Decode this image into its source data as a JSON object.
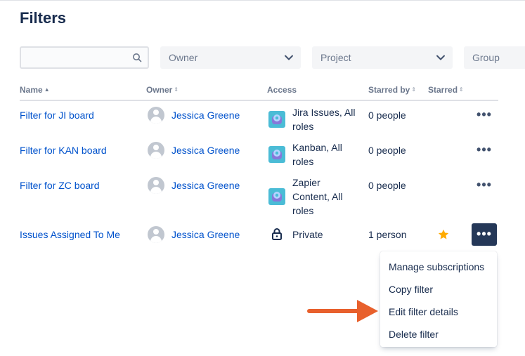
{
  "page": {
    "title": "Filters"
  },
  "search": {
    "placeholder": ""
  },
  "selects": [
    {
      "label": "Owner"
    },
    {
      "label": "Project"
    },
    {
      "label": "Group"
    }
  ],
  "table": {
    "headers": [
      "Name",
      "Owner",
      "Access",
      "Starred by",
      "Starred"
    ],
    "rows": [
      {
        "name": "Filter for JI board",
        "owner": "Jessica Greene",
        "access_lines": [
          "Jira Issues, All",
          "roles"
        ],
        "access_icon": "project-avatar-icon",
        "starred_by": "0 people",
        "starred": false
      },
      {
        "name": "Filter for KAN board",
        "owner": "Jessica Greene",
        "access_lines": [
          "Kanban, All",
          "roles"
        ],
        "access_icon": "project-avatar-icon",
        "starred_by": "0 people",
        "starred": false
      },
      {
        "name": "Filter for ZC board",
        "owner": "Jessica Greene",
        "access_lines": [
          "Zapier",
          "Content, All",
          "roles"
        ],
        "access_icon": "project-avatar-icon",
        "starred_by": "0 people",
        "starred": false
      },
      {
        "name": "Issues Assigned To Me",
        "owner": "Jessica Greene",
        "access_lines": [
          "Private"
        ],
        "access_icon": "lock-icon",
        "starred_by": "1 person",
        "starred": true
      }
    ]
  },
  "more_label": "•••",
  "menu": {
    "items": [
      "Manage subscriptions",
      "Copy filter",
      "Edit filter details",
      "Delete filter"
    ]
  },
  "colors": {
    "link": "#0052cc",
    "star": "#ffab00",
    "active_button": "#253858",
    "annotation_arrow": "#e8602c"
  }
}
